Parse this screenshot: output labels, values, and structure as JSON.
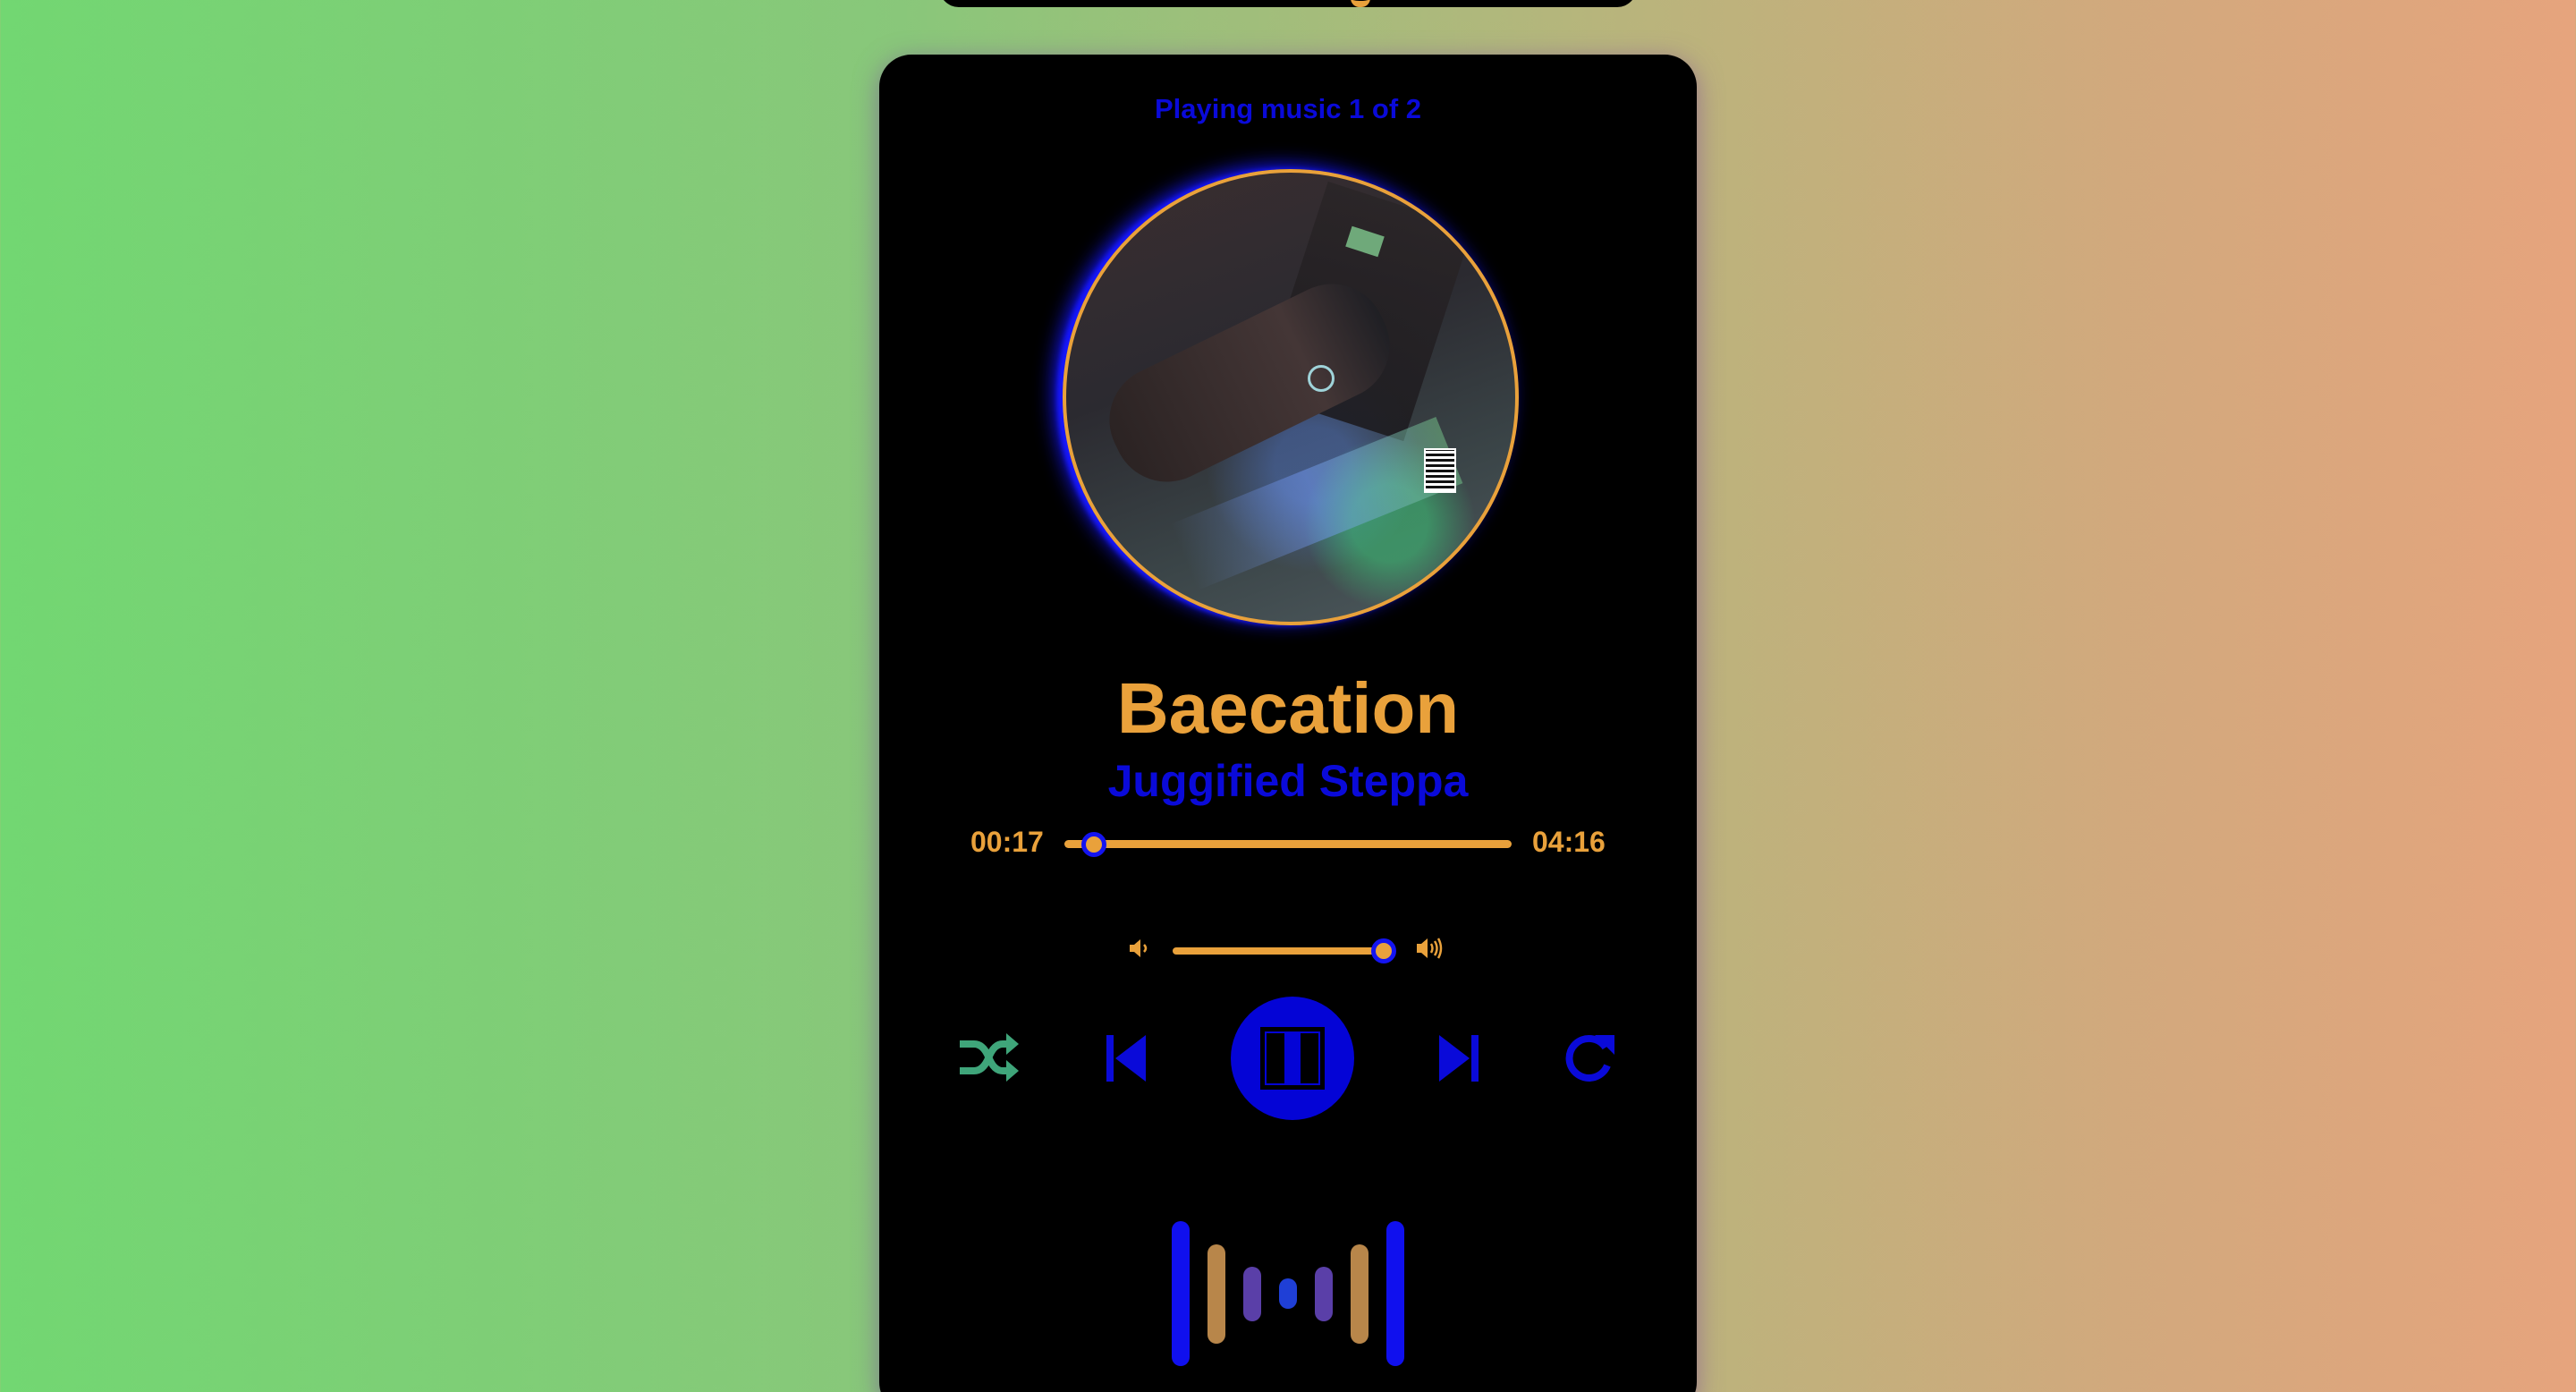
{
  "status": {
    "now_playing": "Playing music 1 of 2"
  },
  "track": {
    "title": "Baecation",
    "artist": "Juggified Steppa"
  },
  "progress": {
    "current": "00:17",
    "total": "04:16",
    "fraction": 0.066
  },
  "volume": {
    "level": 0.95
  },
  "controls": {
    "shuffle": "shuffle-icon",
    "previous": "previous-track-icon",
    "play_pause": "pause-icon",
    "next": "next-track-icon",
    "repeat": "repeat-icon"
  },
  "visualizer": {
    "bar_levels": [
      0.95,
      0.65,
      0.36,
      0.2,
      0.36,
      0.65,
      0.95
    ]
  },
  "colors": {
    "accent_orange": "#e9a13b",
    "accent_blue": "#0a0ad9",
    "shuffle_green": "#3fa57a",
    "panel": "#000000"
  }
}
